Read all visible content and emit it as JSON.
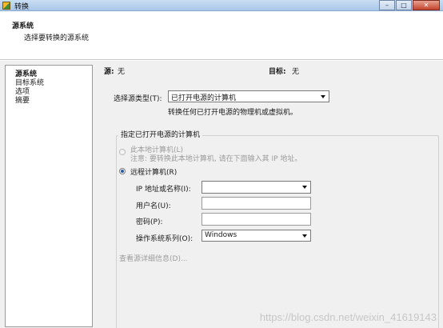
{
  "window": {
    "title": "转换"
  },
  "header": {
    "title": "源系统",
    "subtitle": "选择要转换的源系统"
  },
  "sidebar": {
    "items": [
      {
        "label": "源系统",
        "selected": true
      },
      {
        "label": "目标系统"
      },
      {
        "label": "选项"
      },
      {
        "label": "摘要"
      }
    ]
  },
  "summary": {
    "source_label": "源:",
    "source_value": "无",
    "target_label": "目标:",
    "target_value": "无"
  },
  "source_type": {
    "label": "选择源类型(T):",
    "value": "已打开电源的计算机",
    "hint": "转换任何已打开电源的物理机或虚拟机。"
  },
  "group": {
    "title": "指定已打开电源的计算机",
    "local_radio": {
      "label": "此本地计算机(L)",
      "note": "注意: 要转换此本地计算机, 请在下面输入其 IP 地址。"
    },
    "remote_radio": {
      "label": "远程计算机(R)"
    },
    "ip_field": {
      "label": "IP 地址或名称(I):",
      "value": ""
    },
    "user_field": {
      "label": "用户名(U):",
      "value": ""
    },
    "password_field": {
      "label": "密码(P):",
      "value": ""
    },
    "os_field": {
      "label": "操作系统系列(O):",
      "value": "Windows"
    },
    "details_link": "查看源详细信息(D)..."
  },
  "watermark": "https://blog.csdn.net/weixin_41619143",
  "colors": {
    "title_bar": "#a9c6e8",
    "panel": "#f0f0f0",
    "radio_dot": "#2c5aa0"
  }
}
